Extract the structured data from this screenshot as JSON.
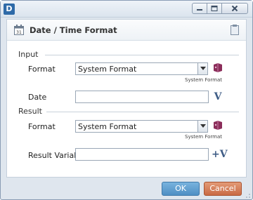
{
  "window": {
    "app_icon": "D",
    "controls": [
      "minimize-icon",
      "maximize-icon",
      "close-icon"
    ]
  },
  "header": {
    "title": "Date / Time Format",
    "icon": "calendar-icon",
    "help_icon": "clipboard-icon"
  },
  "input": {
    "section_label": "Input",
    "format_label": "Format",
    "format_value": "System Format",
    "format_hint": "System Format",
    "date_label": "Date",
    "date_value": "",
    "variable_button": "V"
  },
  "result": {
    "section_label": "Result",
    "format_label": "Format",
    "format_value": "System Format",
    "format_hint": "System Format",
    "variable_label": "Result Variable",
    "variable_value": "",
    "add_variable_button": "+V"
  },
  "footer": {
    "ok_label": "OK",
    "cancel_label": "Cancel"
  },
  "colors": {
    "ok": "#5b9bd0",
    "cancel": "#d07550",
    "accent": "#2e6aa8"
  }
}
